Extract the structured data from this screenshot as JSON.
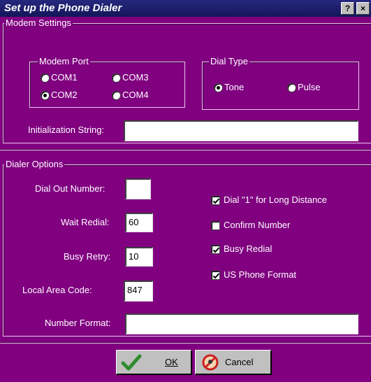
{
  "window": {
    "title": "Set up the Phone Dialer",
    "help_label": "?",
    "close_label": "×"
  },
  "modem_settings": {
    "group_label": "Modem Settings",
    "modem_port": {
      "group_label": "Modem Port",
      "options": [
        {
          "label": "COM1",
          "selected": false
        },
        {
          "label": "COM3",
          "selected": false
        },
        {
          "label": "COM2",
          "selected": true
        },
        {
          "label": "COM4",
          "selected": false
        }
      ]
    },
    "dial_type": {
      "group_label": "Dial Type",
      "options": [
        {
          "label": "Tone",
          "selected": true
        },
        {
          "label": "Pulse",
          "selected": false
        }
      ]
    },
    "init_string": {
      "label": "Initialization String:",
      "value": ""
    }
  },
  "dialer_options": {
    "group_label": "Dialer Options",
    "fields": {
      "dial_out": {
        "label": "Dial Out Number:",
        "value": ""
      },
      "wait_redial": {
        "label": "Wait Redial:",
        "value": "60"
      },
      "busy_retry": {
        "label": "Busy Retry:",
        "value": "10"
      },
      "local_area_code": {
        "label": "Local Area Code:",
        "value": "847"
      },
      "number_format": {
        "label": "Number Format:",
        "value": ""
      }
    },
    "checkboxes": [
      {
        "label": "Dial \"1\" for Long Distance",
        "checked": true
      },
      {
        "label": "Confirm Number",
        "checked": false
      },
      {
        "label": "Busy Redial",
        "checked": true
      },
      {
        "label": "US Phone Format",
        "checked": true
      }
    ]
  },
  "buttons": {
    "ok": {
      "label": "OK",
      "icon": "checkmark-icon"
    },
    "cancel": {
      "label": "Cancel",
      "icon": "cancel-icon"
    }
  },
  "colors": {
    "dialog_bg": "#800080",
    "titlebar": "#1d1f6b",
    "ok_check": "#2e8b2e",
    "cancel_icon": "#cc2020"
  }
}
